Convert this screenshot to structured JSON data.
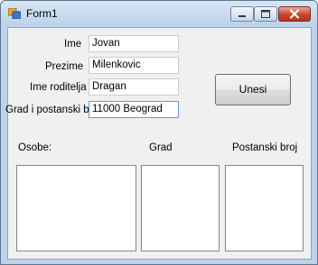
{
  "window": {
    "title": "Form1"
  },
  "icons": {
    "app": "form-icon",
    "minimize": "minimize-icon",
    "maximize": "maximize-icon",
    "close": "close-icon"
  },
  "form": {
    "ime": {
      "label": "Ime",
      "value": "Jovan"
    },
    "prezime": {
      "label": "Prezime",
      "value": "Milenkovic"
    },
    "ime_roditelja": {
      "label": "Ime roditelja",
      "value": "Dragan"
    },
    "grad_postanski": {
      "label": "Grad i postanski br.",
      "value": "11000 Beograd"
    }
  },
  "button": {
    "label": "Unesi"
  },
  "lists": {
    "osobe": {
      "label": "Osobe:"
    },
    "grad": {
      "label": "Grad"
    },
    "postanski_broj": {
      "label": "Postanski broj"
    }
  },
  "colors": {
    "frame": "#bdd3ec",
    "client": "#f0f0f0",
    "close": "#c9452f"
  }
}
